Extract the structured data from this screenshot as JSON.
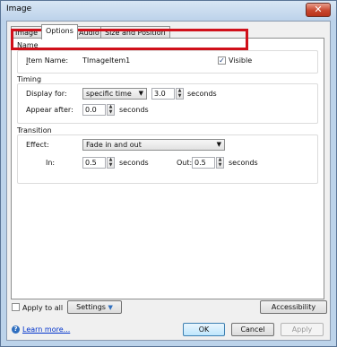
{
  "window": {
    "title": "Image",
    "close_glyph": "✕"
  },
  "tabs": [
    {
      "label": "Image"
    },
    {
      "label": "Options"
    },
    {
      "label": "Audio"
    },
    {
      "label": "Size and Position"
    }
  ],
  "name_group": {
    "label": "Name",
    "item_name_label": "Item Name:",
    "item_name_value": "TImageItem1",
    "visible_label": "Visible",
    "visible_checked": true,
    "check_glyph": "✓",
    "highlight_color": "#d0101a"
  },
  "timing_group": {
    "label": "Timing",
    "display_for_label": "Display for:",
    "display_for_value": "specific time",
    "duration_value": "3.0",
    "duration_unit": "seconds",
    "appear_after_label": "Appear after:",
    "appear_after_value": "0.0",
    "appear_after_unit": "seconds"
  },
  "transition_group": {
    "label": "Transition",
    "effect_label": "Effect:",
    "effect_value": "Fade in and out",
    "in_label": "In:",
    "in_value": "0.5",
    "in_unit": "seconds",
    "out_label": "Out:",
    "out_value": "0.5",
    "out_unit": "seconds"
  },
  "footer": {
    "apply_to_all_label": "Apply to all",
    "settings_label": "Settings",
    "settings_arrow": "▼",
    "accessibility_label": "Accessibility",
    "learn_more_label": "Learn more...",
    "ok_label": "OK",
    "cancel_label": "Cancel",
    "apply_label": "Apply"
  },
  "icons": {
    "dropdown_arrow": "▼",
    "spin_up": "▲",
    "spin_down": "▼",
    "help": "?"
  }
}
